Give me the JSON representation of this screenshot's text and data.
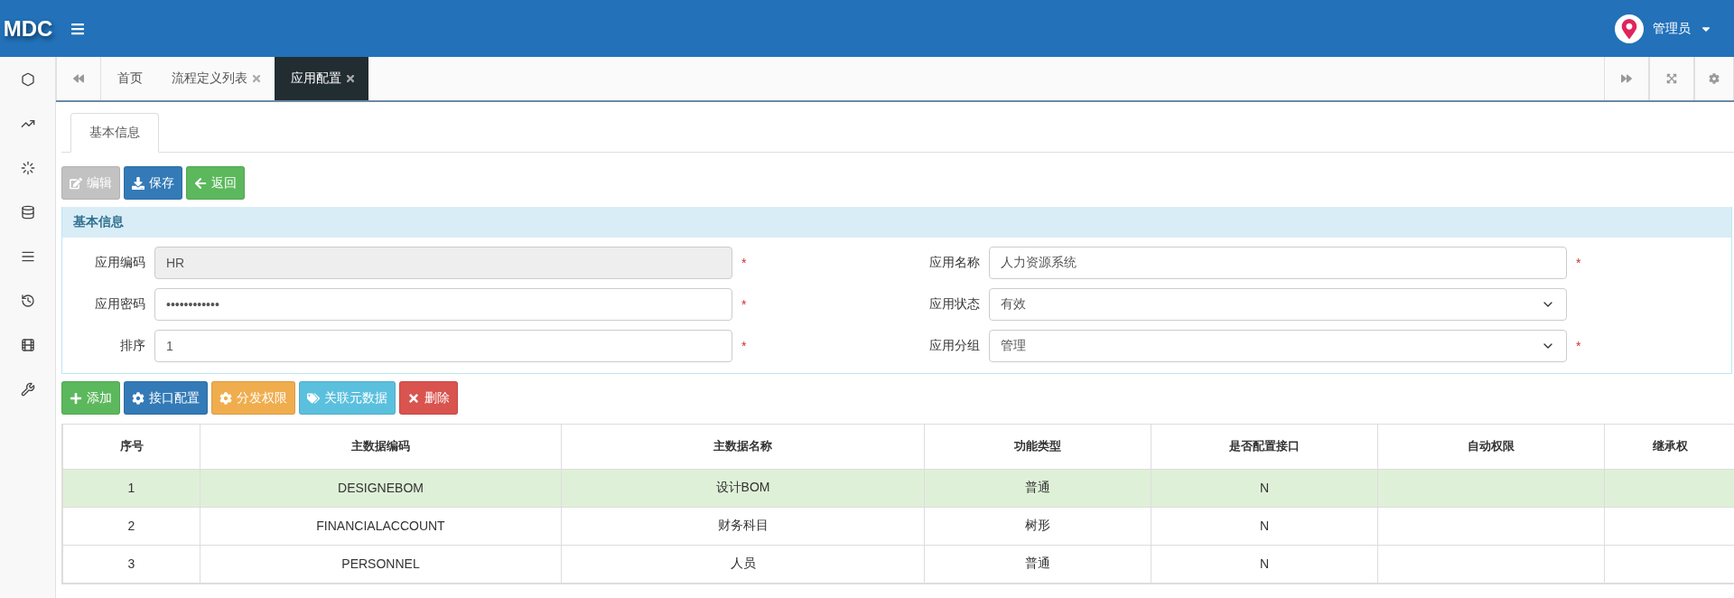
{
  "header": {
    "logo": "MDC",
    "user": "管理员"
  },
  "tabs": [
    {
      "label": "首页",
      "selected": false,
      "closable": false
    },
    {
      "label": "流程定义列表",
      "selected": false,
      "closable": true
    },
    {
      "label": "应用配置",
      "selected": true,
      "closable": true
    }
  ],
  "subtabs": [
    {
      "label": "基本信息",
      "selected": true
    }
  ],
  "toolbar": [
    {
      "label": "编辑",
      "kind": "edit",
      "disabled": true
    },
    {
      "label": "保存",
      "kind": "save",
      "disabled": false
    },
    {
      "label": "返回",
      "kind": "back",
      "disabled": false
    }
  ],
  "panel": {
    "title": "基本信息",
    "fields": [
      {
        "label": "应用编码",
        "value": "HR",
        "kind": "text",
        "disabled": true,
        "mark": "*"
      },
      {
        "label": "应用名称",
        "value": "人力资源系统",
        "kind": "text",
        "disabled": false,
        "mark": "*"
      },
      {
        "label": "应用密码",
        "value": "••••••••••••",
        "kind": "text",
        "disabled": false,
        "mark": "*"
      },
      {
        "label": "应用状态",
        "value": "有效",
        "kind": "select",
        "disabled": false
      },
      {
        "label": "排序",
        "value": "1",
        "kind": "text",
        "disabled": false,
        "mark": "*"
      },
      {
        "label": "应用分组",
        "value": "管理",
        "kind": "select",
        "disabled": false,
        "mark": "*"
      }
    ]
  },
  "actions": [
    {
      "label": "添加",
      "kind": "add"
    },
    {
      "label": "接口配置",
      "kind": "config"
    },
    {
      "label": "分发权限",
      "kind": "distribute"
    },
    {
      "label": "关联元数据",
      "kind": "link"
    },
    {
      "label": "删除",
      "kind": "delete"
    }
  ],
  "table": {
    "columns": [
      "序号",
      "主数据编码",
      "主数据名称",
      "功能类型",
      "是否配置接口",
      "自动权限",
      "继承权"
    ],
    "rows": [
      {
        "selected": true,
        "cells": [
          "1",
          "DESIGNEBOM",
          "设计BOM",
          "普通",
          "N"
        ]
      },
      {
        "selected": false,
        "cells": [
          "2",
          "FINANCIALACCOUNT",
          "财务科目",
          "树形",
          "N"
        ]
      },
      {
        "selected": false,
        "cells": [
          "3",
          "PERSONNEL",
          "人员",
          "普通",
          "N"
        ]
      }
    ]
  }
}
